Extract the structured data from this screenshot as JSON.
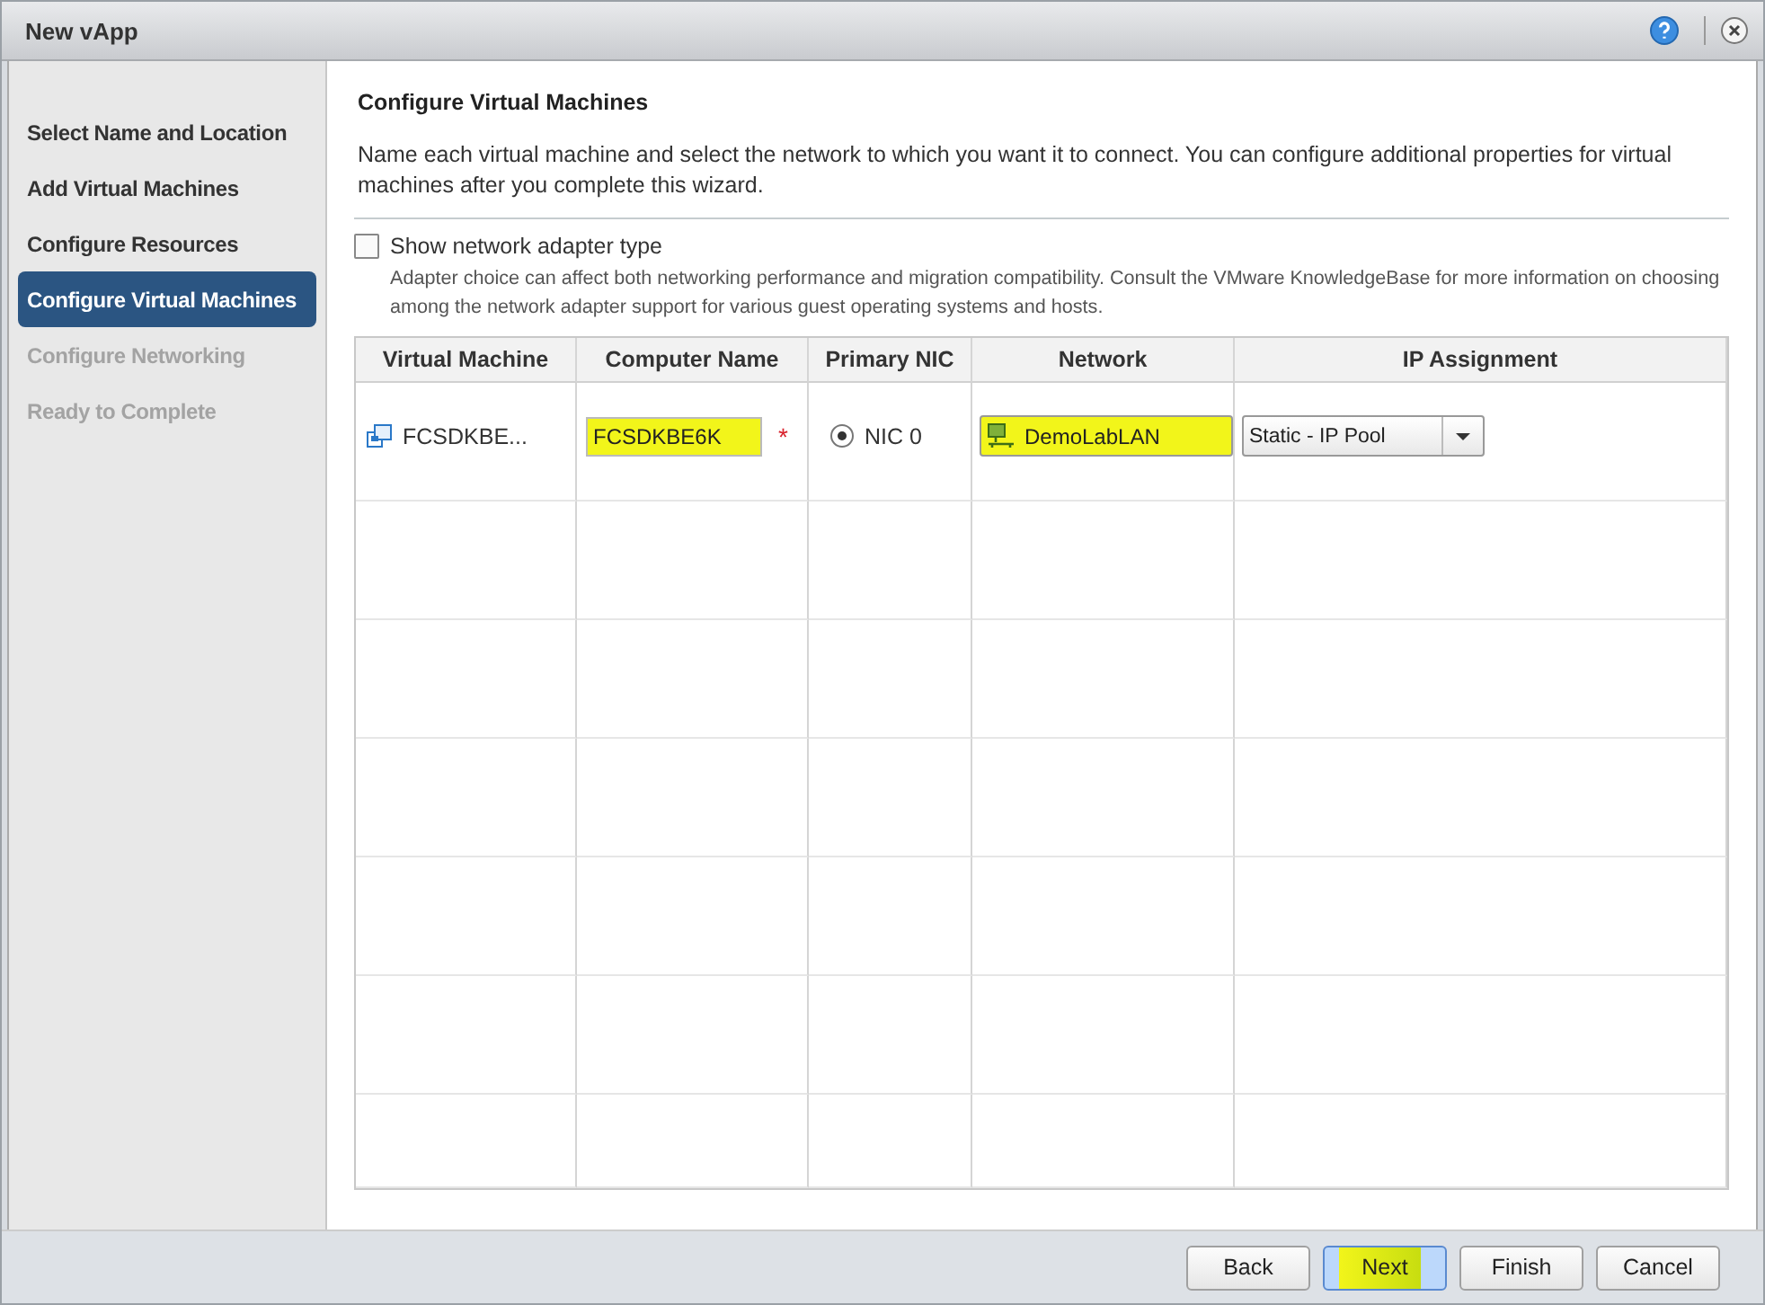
{
  "window": {
    "title": "New vApp"
  },
  "steps": [
    {
      "label": "Select Name and Location",
      "selected": false,
      "disabled": false
    },
    {
      "label": "Add Virtual Machines",
      "selected": false,
      "disabled": false
    },
    {
      "label": "Configure Resources",
      "selected": false,
      "disabled": false
    },
    {
      "label": "Configure Virtual Machines",
      "selected": true,
      "disabled": false
    },
    {
      "label": "Configure Networking",
      "selected": false,
      "disabled": true
    },
    {
      "label": "Ready to Complete",
      "selected": false,
      "disabled": true
    }
  ],
  "page": {
    "title": "Configure Virtual Machines",
    "description": "Name each virtual machine and select the network to which you want it to connect. You can configure additional properties for virtual machines after you complete this wizard."
  },
  "adapter_option": {
    "label": "Show network adapter type",
    "checked": false,
    "hint": "Adapter choice can affect both networking performance and migration compatibility. Consult the VMware KnowledgeBase for more information on choosing among the network adapter support for various guest operating systems and hosts."
  },
  "table": {
    "columns": [
      "Virtual Machine",
      "Computer Name",
      "Primary NIC",
      "Network",
      "IP Assignment"
    ],
    "rows": [
      {
        "virtual_machine": "FCSDKBE...",
        "computer_name": "FCSDKBE6K",
        "computer_name_highlighted": true,
        "required_mark": "*",
        "nic": "NIC 0",
        "nic_selected": true,
        "network": "DemoLabLAN",
        "network_highlighted": true,
        "ip_assignment": "Static - IP Pool"
      }
    ]
  },
  "buttons": [
    {
      "label": "Back",
      "primary": false,
      "highlighted": false
    },
    {
      "label": "Next",
      "primary": true,
      "highlighted": true
    },
    {
      "label": "Finish",
      "primary": false,
      "highlighted": false
    },
    {
      "label": "Cancel",
      "primary": false,
      "highlighted": false
    }
  ]
}
